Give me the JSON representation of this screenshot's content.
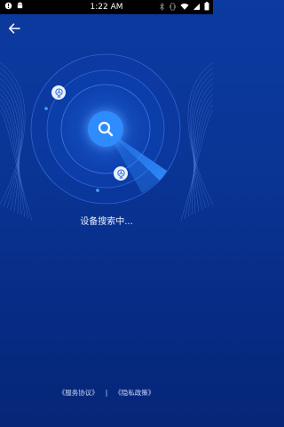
{
  "status_bar": {
    "time": "1:22 AM",
    "left_icons": [
      "notification-icon",
      "android-icon"
    ],
    "right_icons": [
      "bluetooth-icon",
      "vibrate-icon",
      "wifi-icon",
      "signal-icon",
      "battery-icon"
    ]
  },
  "header": {
    "back_icon": "arrow-left-icon"
  },
  "radar": {
    "center_icon": "search-icon",
    "device_icon": "fan-icon",
    "accent_color": "#2f8cff"
  },
  "status_text": "设备搜索中...",
  "footer": {
    "service_agreement": "《服务协议》",
    "separator": "|",
    "privacy_policy": "《隐私政策》"
  }
}
